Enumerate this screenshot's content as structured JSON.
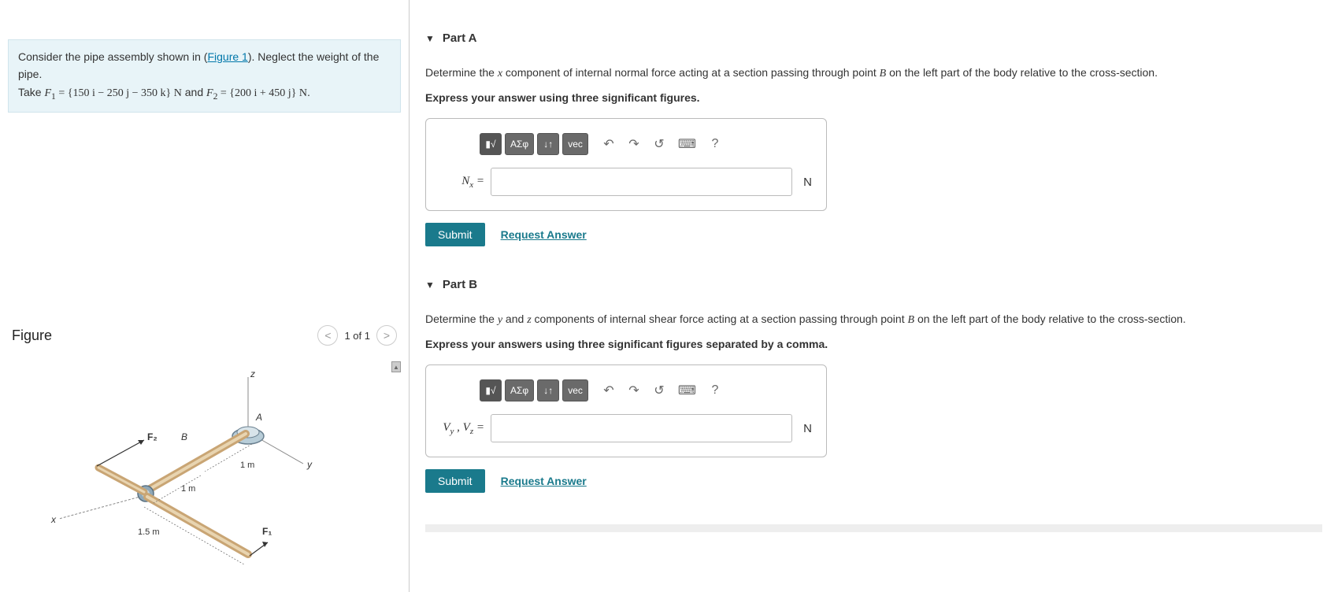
{
  "problem": {
    "text_prefix": "Consider the pipe assembly shown in (",
    "figure_link": "Figure 1",
    "text_after_link": "). Neglect the weight of the pipe.",
    "take_prefix": "Take ",
    "f1_label": "F",
    "f1_sub": "1",
    "eq1": " = {150 i − 250 j − 350 k} N",
    "and": " and ",
    "f2_label": "F",
    "f2_sub": "2",
    "eq2": " = {200 i + 450 j} N",
    "period": "."
  },
  "figure": {
    "title": "Figure",
    "count": "1 of 1",
    "labels": {
      "z": "z",
      "y": "y",
      "x": "x",
      "A": "A",
      "B": "B",
      "F1": "F₁",
      "F2": "F₂",
      "d1": "1 m",
      "d2": "1 m",
      "d3": "1.5 m"
    }
  },
  "partA": {
    "title": "Part A",
    "question_p1": "Determine the ",
    "question_var": "x",
    "question_p2": " component of internal normal force acting at a section passing through point ",
    "question_pt": "B",
    "question_p3": " on the left part of the body relative to the cross-section.",
    "instruction": "Express your answer using three significant figures.",
    "label_main": "N",
    "label_sub": "x",
    "equals": " =",
    "unit": "N",
    "submit": "Submit",
    "request": "Request Answer"
  },
  "partB": {
    "title": "Part B",
    "question_p1": "Determine the ",
    "question_var1": "y",
    "question_and": " and ",
    "question_var2": "z",
    "question_p2": " components of internal shear force acting at a section passing through point ",
    "question_pt": "B",
    "question_p3": " on the left part of the body relative to the cross-section.",
    "instruction": "Express your answers using three significant figures separated by a comma.",
    "label_v1": "V",
    "label_s1": "y",
    "label_comma": " , ",
    "label_v2": "V",
    "label_s2": "z",
    "equals": " =",
    "unit": "N",
    "submit": "Submit",
    "request": "Request Answer"
  },
  "toolbar": {
    "templates": "▮√",
    "greek": "ΑΣφ",
    "subsup": "↓↑",
    "vec": "vec",
    "undo": "↶",
    "redo": "↷",
    "reset": "↺",
    "keyboard": "⌨",
    "help": "?"
  }
}
